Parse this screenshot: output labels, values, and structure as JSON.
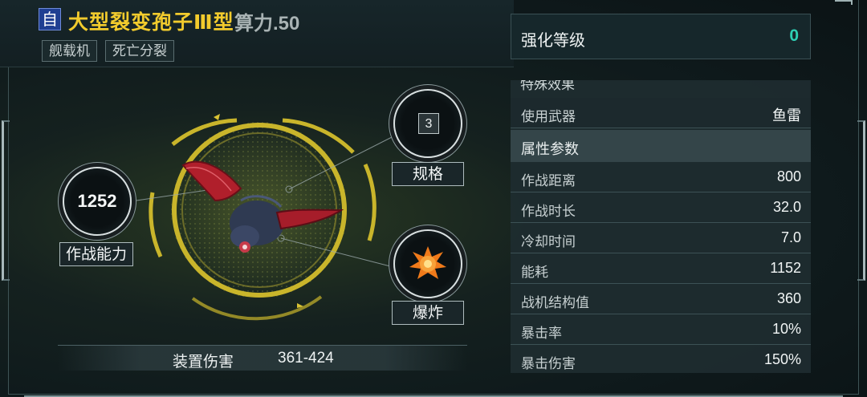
{
  "header": {
    "owner_badge": "自",
    "unit_name": "大型裂变孢子Ⅲ型",
    "power": "算力.50",
    "tags": [
      "舰载机",
      "死亡分裂"
    ]
  },
  "enhance": {
    "label": "强化等级",
    "value": "0"
  },
  "combat": {
    "ability_value": "1252",
    "ability_label": "作战能力",
    "spec_value": "3",
    "spec_label": "规格",
    "explode_label": "爆炸",
    "explode_icon": "explosion-icon"
  },
  "damage": {
    "label": "装置伤害",
    "value": "361-424"
  },
  "stats": {
    "special_effect_label": "特殊效果",
    "weapon": {
      "key": "使用武器",
      "value": "鱼雷"
    },
    "params_label": "属性参数",
    "rows": [
      {
        "key": "作战距离",
        "value": "800"
      },
      {
        "key": "作战时长",
        "value": "32.0"
      },
      {
        "key": "冷却时间",
        "value": "7.0"
      },
      {
        "key": "能耗",
        "value": "1152"
      },
      {
        "key": "战机结构值",
        "value": "360"
      },
      {
        "key": "暴击率",
        "value": "10%"
      },
      {
        "key": "暴击伤害",
        "value": "150%"
      }
    ]
  },
  "colors": {
    "title_gold": "#f2cb2d",
    "enhance_teal": "#2ecfb4",
    "ring_gold": "#c9b52b",
    "badge_blue": "#1f3f92"
  }
}
